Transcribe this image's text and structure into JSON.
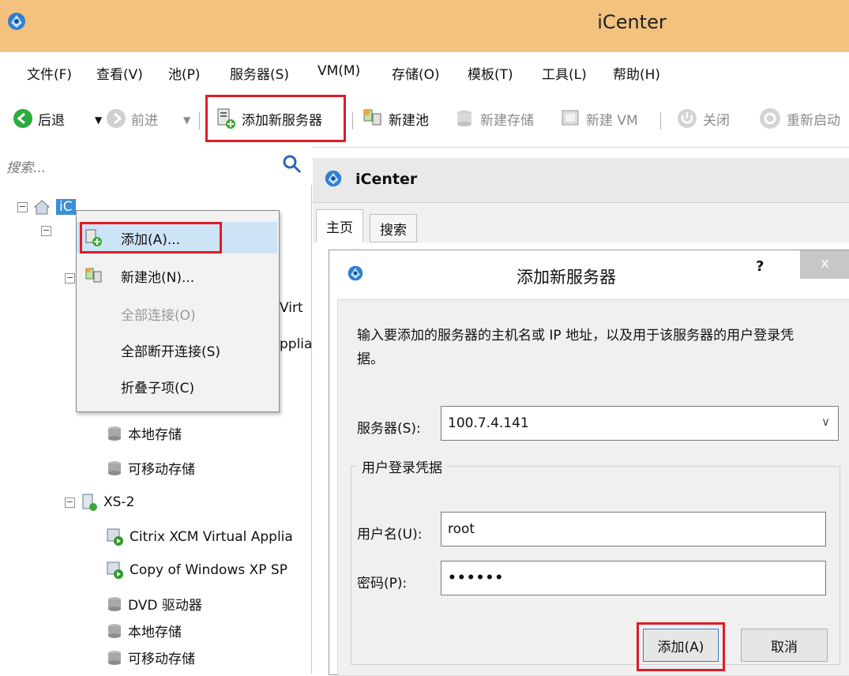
{
  "window": {
    "title": "iCenter"
  },
  "menu": [
    "文件(F)",
    "查看(V)",
    "池(P)",
    "服务器(S)",
    "VM(M)",
    "存储(O)",
    "模板(T)",
    "工具(L)",
    "帮助(H)"
  ],
  "toolbar": {
    "back": "后退",
    "forward": "前进",
    "add_server": "添加新服务器",
    "new_pool": "新建池",
    "new_storage": "新建存储",
    "new_vm": "新建 VM",
    "shutdown": "关闭",
    "restart": "重新启动"
  },
  "search": {
    "placeholder": "搜索..."
  },
  "tree": {
    "root": "iC",
    "partial1": "Virt",
    "partial2": "pplia",
    "partial3": "DVD 驱动器",
    "items_a": [
      "本地存储",
      "可移动存储"
    ],
    "xs2": "XS-2",
    "xs2_children": [
      "Citrix XCM Virtual Applia",
      "Copy of Windows XP SP",
      "DVD 驱动器",
      "本地存储",
      "可移动存储"
    ]
  },
  "context_menu": [
    {
      "label": "添加(A)...",
      "disabled": false
    },
    {
      "label": "新建池(N)...",
      "disabled": false
    },
    {
      "label": "全部连接(O)",
      "disabled": true
    },
    {
      "label": "全部断开连接(S)",
      "disabled": false
    },
    {
      "label": "折叠子项(C)",
      "disabled": false
    }
  ],
  "panel": {
    "header": "iCenter",
    "tabs": [
      "主页",
      "搜索"
    ]
  },
  "dialog": {
    "title": "添加新服务器",
    "help": "?",
    "close": "x",
    "description": "输入要添加的服务器的主机名或 IP 地址，以及用于该服务器的用户登录凭据。",
    "server_label": "服务器(S):",
    "server_value": "100.7.4.141",
    "group_label": "用户登录凭据",
    "username_label": "用户名(U):",
    "username_value": "root",
    "password_label": "密码(P):",
    "password_value": "••••••",
    "add_button": "添加(A)",
    "cancel_button": "取消"
  }
}
